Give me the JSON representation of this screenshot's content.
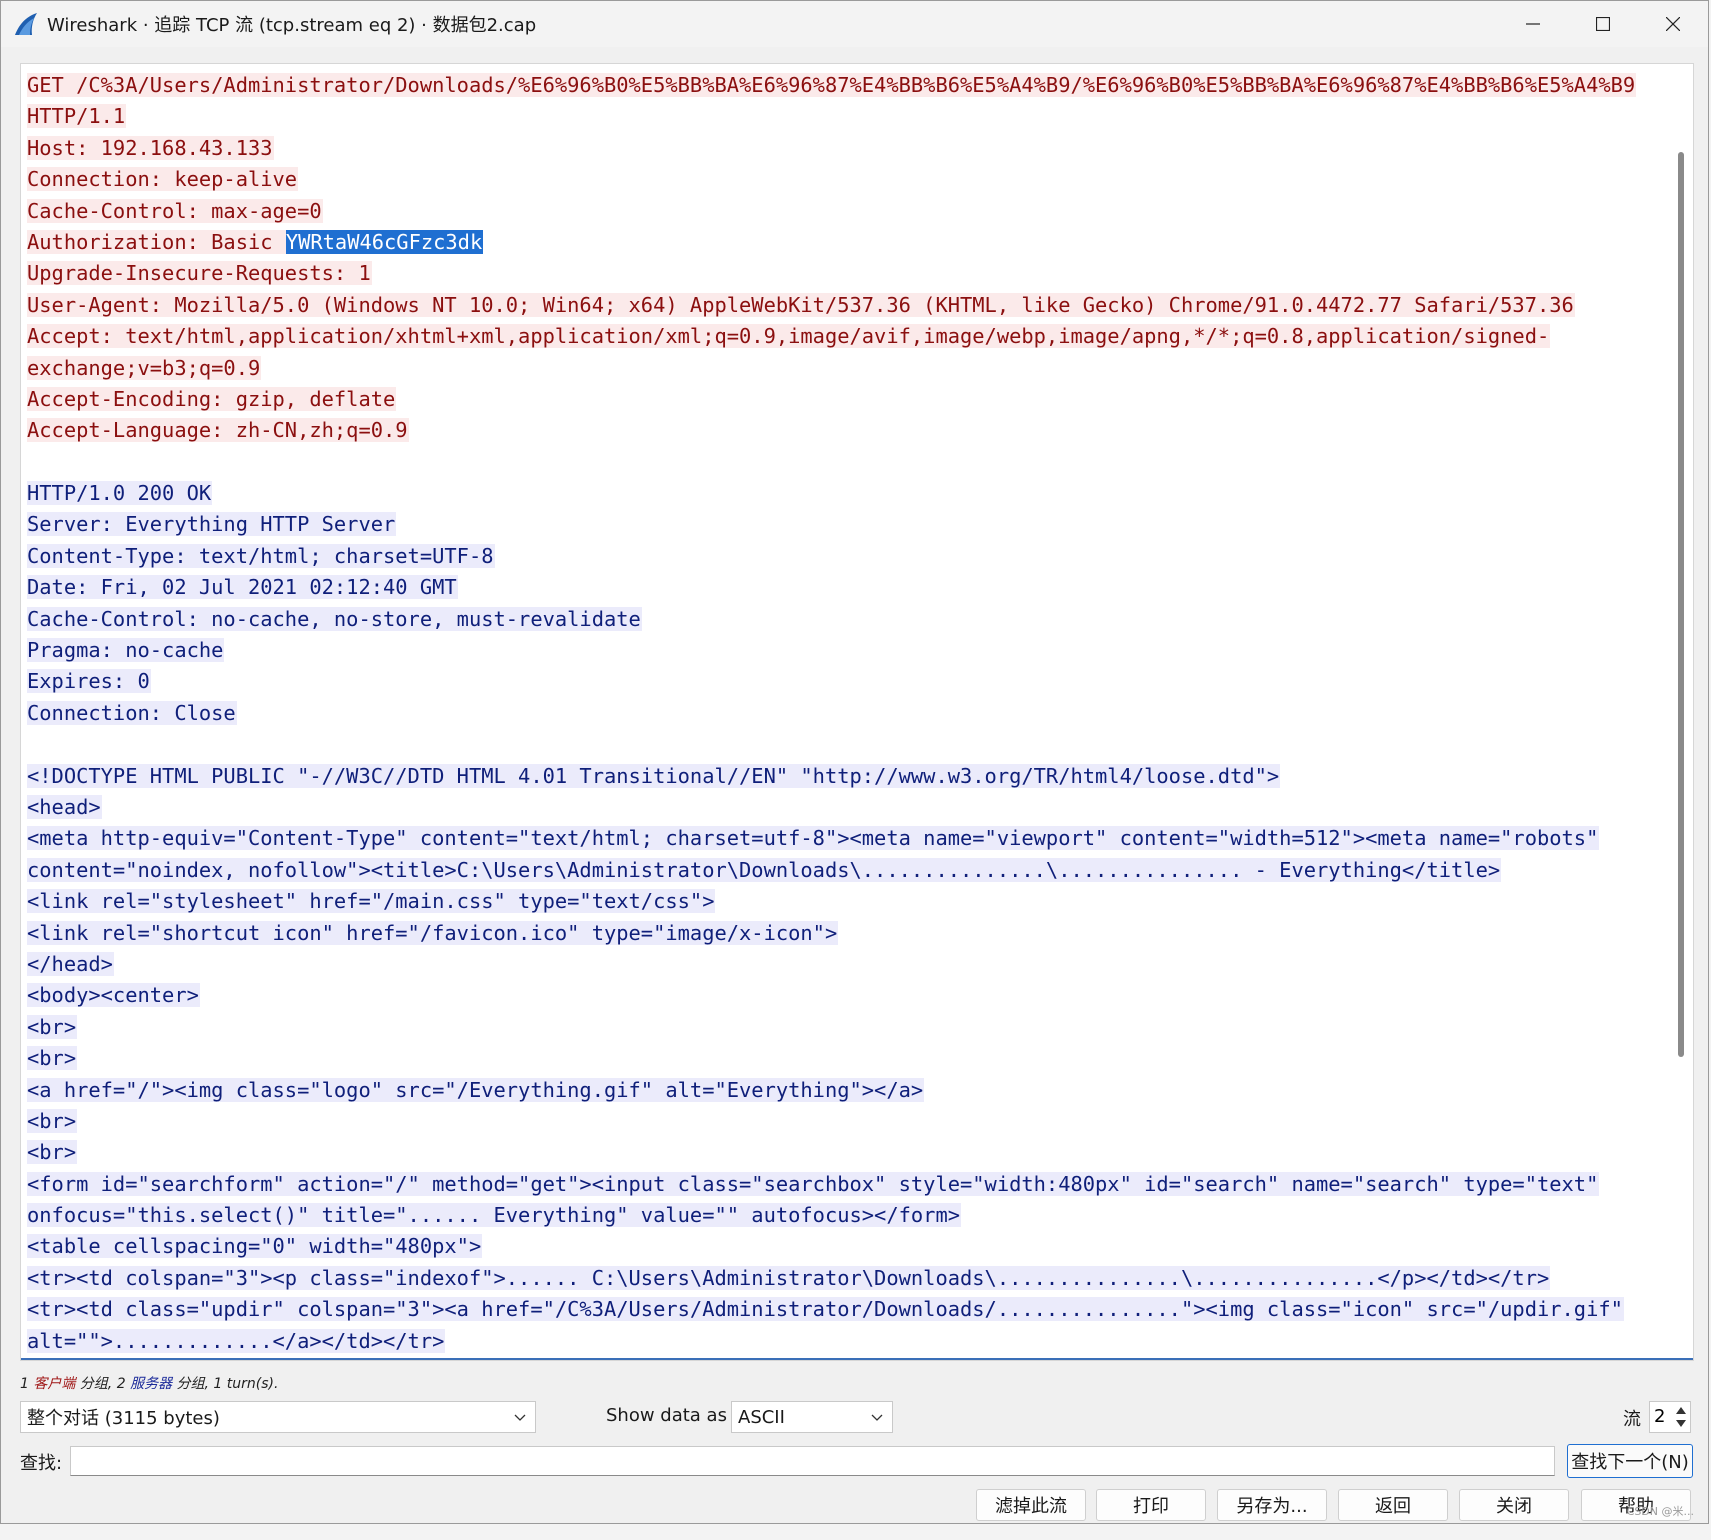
{
  "window": {
    "title": "Wireshark · 追踪 TCP 流 (tcp.stream eq 2) · 数据包2.cap"
  },
  "stream": {
    "lines": [
      {
        "dir": "client",
        "segs": [
          {
            "t": "GET /C%3A/Users/Administrator/Downloads/%E6%96%B0%E5%BB%BA%E6%96%87%E4%BB%B6%E5%A4%B9/%E6%96%B0%E5%BB%BA%E6%96%87%E4%BB%B6%E5%A4%B9"
          }
        ]
      },
      {
        "dir": "client",
        "segs": [
          {
            "t": "HTTP/1.1"
          }
        ]
      },
      {
        "dir": "client",
        "segs": [
          {
            "t": "Host: 192.168.43.133"
          }
        ]
      },
      {
        "dir": "client",
        "segs": [
          {
            "t": "Connection: keep-alive"
          }
        ]
      },
      {
        "dir": "client",
        "segs": [
          {
            "t": "Cache-Control: max-age=0"
          }
        ]
      },
      {
        "dir": "client",
        "segs": [
          {
            "t": "Authorization: Basic "
          },
          {
            "t": "YWRtaW46cGFzc3dk",
            "hl": true
          }
        ]
      },
      {
        "dir": "client",
        "segs": [
          {
            "t": "Upgrade-Insecure-Requests: 1"
          }
        ]
      },
      {
        "dir": "client",
        "segs": [
          {
            "t": "User-Agent: Mozilla/5.0 (Windows NT 10.0; Win64; x64) AppleWebKit/537.36 (KHTML, like Gecko) Chrome/91.0.4472.77 Safari/537.36"
          }
        ]
      },
      {
        "dir": "client",
        "segs": [
          {
            "t": "Accept: text/html,application/xhtml+xml,application/xml;q=0.9,image/avif,image/webp,image/apng,*/*;q=0.8,application/signed-"
          }
        ]
      },
      {
        "dir": "client",
        "segs": [
          {
            "t": "exchange;v=b3;q=0.9"
          }
        ]
      },
      {
        "dir": "client",
        "segs": [
          {
            "t": "Accept-Encoding: gzip, deflate"
          }
        ]
      },
      {
        "dir": "client",
        "segs": [
          {
            "t": "Accept-Language: zh-CN,zh;q=0.9"
          }
        ]
      },
      {
        "dir": "none",
        "segs": [
          {
            "t": ""
          }
        ]
      },
      {
        "dir": "server",
        "segs": [
          {
            "t": "HTTP/1.0 200 OK"
          }
        ]
      },
      {
        "dir": "server",
        "segs": [
          {
            "t": "Server: Everything HTTP Server"
          }
        ]
      },
      {
        "dir": "server",
        "segs": [
          {
            "t": "Content-Type: text/html; charset=UTF-8"
          }
        ]
      },
      {
        "dir": "server",
        "segs": [
          {
            "t": "Date: Fri, 02 Jul 2021 02:12:40 GMT"
          }
        ]
      },
      {
        "dir": "server",
        "segs": [
          {
            "t": "Cache-Control: no-cache, no-store, must-revalidate"
          }
        ]
      },
      {
        "dir": "server",
        "segs": [
          {
            "t": "Pragma: no-cache"
          }
        ]
      },
      {
        "dir": "server",
        "segs": [
          {
            "t": "Expires: 0"
          }
        ]
      },
      {
        "dir": "server",
        "segs": [
          {
            "t": "Connection: Close"
          }
        ]
      },
      {
        "dir": "none",
        "segs": [
          {
            "t": ""
          }
        ]
      },
      {
        "dir": "server",
        "segs": [
          {
            "t": "<!DOCTYPE HTML PUBLIC \"-//W3C//DTD HTML 4.01 Transitional//EN\" \"http://www.w3.org/TR/html4/loose.dtd\">"
          }
        ]
      },
      {
        "dir": "server",
        "segs": [
          {
            "t": "<head>"
          }
        ]
      },
      {
        "dir": "server",
        "segs": [
          {
            "t": "<meta http-equiv=\"Content-Type\" content=\"text/html; charset=utf-8\"><meta name=\"viewport\" content=\"width=512\"><meta name=\"robots\""
          }
        ]
      },
      {
        "dir": "server",
        "segs": [
          {
            "t": "content=\"noindex, nofollow\"><title>C:\\Users\\Administrator\\Downloads\\...............\\............... - Everything</title>"
          }
        ]
      },
      {
        "dir": "server",
        "segs": [
          {
            "t": "<link rel=\"stylesheet\" href=\"/main.css\" type=\"text/css\">"
          }
        ]
      },
      {
        "dir": "server",
        "segs": [
          {
            "t": "<link rel=\"shortcut icon\" href=\"/favicon.ico\" type=\"image/x-icon\">"
          }
        ]
      },
      {
        "dir": "server",
        "segs": [
          {
            "t": "</head>"
          }
        ]
      },
      {
        "dir": "server",
        "segs": [
          {
            "t": "<body><center>"
          }
        ]
      },
      {
        "dir": "server",
        "segs": [
          {
            "t": "<br>"
          }
        ]
      },
      {
        "dir": "server",
        "segs": [
          {
            "t": "<br>"
          }
        ]
      },
      {
        "dir": "server",
        "segs": [
          {
            "t": "<a href=\"/\"><img class=\"logo\" src=\"/Everything.gif\" alt=\"Everything\"></a>"
          }
        ]
      },
      {
        "dir": "server",
        "segs": [
          {
            "t": "<br>"
          }
        ]
      },
      {
        "dir": "server",
        "segs": [
          {
            "t": "<br>"
          }
        ]
      },
      {
        "dir": "server",
        "segs": [
          {
            "t": "<form id=\"searchform\" action=\"/\" method=\"get\"><input class=\"searchbox\" style=\"width:480px\" id=\"search\" name=\"search\" type=\"text\""
          }
        ]
      },
      {
        "dir": "server",
        "segs": [
          {
            "t": "onfocus=\"this.select()\" title=\"...... Everything\" value=\"\" autofocus></form>"
          }
        ]
      },
      {
        "dir": "server",
        "segs": [
          {
            "t": "<table cellspacing=\"0\" width=\"480px\">"
          }
        ]
      },
      {
        "dir": "server",
        "segs": [
          {
            "t": "<tr><td colspan=\"3\"><p class=\"indexof\">...... C:\\Users\\Administrator\\Downloads\\...............\\...............</p></td></tr>"
          }
        ]
      },
      {
        "dir": "server",
        "segs": [
          {
            "t": "<tr><td class=\"updir\" colspan=\"3\"><a href=\"/C%3A/Users/Administrator/Downloads/...............\"><img class=\"icon\" src=\"/updir.gif\""
          }
        ]
      },
      {
        "dir": "server",
        "segs": [
          {
            "t": "alt=\"\">.............</a></td></tr>"
          }
        ]
      }
    ],
    "colors": {
      "client_fg": "#8b0f0f",
      "client_bg": "#fbeaea",
      "server_fg": "#0f1f7a",
      "server_bg": "#ebebfb",
      "highlight": "#1f6fd1"
    }
  },
  "status": {
    "p1": "1 ",
    "client_word": "客户端",
    "p2": " 分组, 2 ",
    "server_word": "服务器",
    "p3": " 分组, 1 turn(s)."
  },
  "controls": {
    "conversation_value": "整个对话 (3115 bytes)",
    "show_data_label": "Show data as",
    "show_data_value": "ASCII",
    "stream_label": "流",
    "stream_value": "2",
    "find_label": "查找:",
    "find_value": "",
    "find_next": "查找下一个(N)"
  },
  "buttons": {
    "filter": "滤掉此流",
    "print": "打印",
    "save_as": "另存为...",
    "back": "返回",
    "close": "关闭",
    "help": "帮助"
  },
  "watermark": "CSDN @米..."
}
